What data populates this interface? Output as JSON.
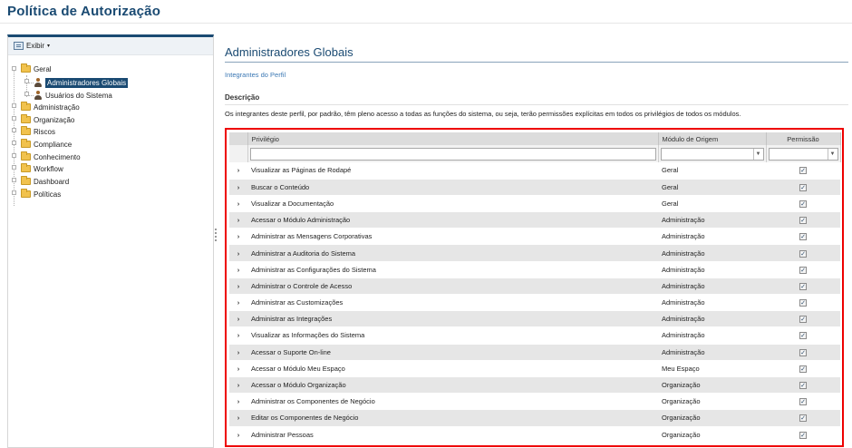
{
  "page": {
    "title": "Política de Autorização"
  },
  "sidebar": {
    "view_label": "Exibir",
    "tree": [
      {
        "label": "Geral",
        "type": "folder",
        "children": [
          {
            "label": "Administradores Globais",
            "type": "user",
            "selected": true
          },
          {
            "label": "Usuários do Sistema",
            "type": "user",
            "selected": false
          }
        ]
      },
      {
        "label": "Administração",
        "type": "folder"
      },
      {
        "label": "Organização",
        "type": "folder"
      },
      {
        "label": "Riscos",
        "type": "folder"
      },
      {
        "label": "Compliance",
        "type": "folder"
      },
      {
        "label": "Conhecimento",
        "type": "folder"
      },
      {
        "label": "Workflow",
        "type": "folder"
      },
      {
        "label": "Dashboard",
        "type": "folder"
      },
      {
        "label": "Políticas",
        "type": "folder"
      }
    ]
  },
  "main": {
    "title": "Administradores Globais",
    "profile_link": "Integrantes do Perfil",
    "description_heading": "Descrição",
    "description_text": "Os integrantes deste perfil, por padrão, têm pleno acesso a todas as funções do sistema, ou seja, terão permissões explícitas em todos os privilégios de todos os módulos.",
    "grid": {
      "columns": [
        "Privilégio",
        "Módulo de Origem",
        "Permissão"
      ],
      "filter_placeholder": "",
      "rows": [
        {
          "privilege": "Visualizar as Páginas de Rodapé",
          "module": "Geral",
          "permission": true
        },
        {
          "privilege": "Buscar o Conteúdo",
          "module": "Geral",
          "permission": true
        },
        {
          "privilege": "Visualizar a Documentação",
          "module": "Geral",
          "permission": true
        },
        {
          "privilege": "Acessar o Módulo Administração",
          "module": "Administração",
          "permission": true
        },
        {
          "privilege": "Administrar as Mensagens Corporativas",
          "module": "Administração",
          "permission": true
        },
        {
          "privilege": "Administrar a Auditoria do Sistema",
          "module": "Administração",
          "permission": true
        },
        {
          "privilege": "Administrar as Configurações do Sistema",
          "module": "Administração",
          "permission": true
        },
        {
          "privilege": "Administrar o Controle de Acesso",
          "module": "Administração",
          "permission": true
        },
        {
          "privilege": "Administrar as Customizações",
          "module": "Administração",
          "permission": true
        },
        {
          "privilege": "Administrar as Integrações",
          "module": "Administração",
          "permission": true
        },
        {
          "privilege": "Visualizar as Informações do Sistema",
          "module": "Administração",
          "permission": true
        },
        {
          "privilege": "Acessar o Suporte On-line",
          "module": "Administração",
          "permission": true
        },
        {
          "privilege": "Acessar o Módulo Meu Espaço",
          "module": "Meu Espaço",
          "permission": true
        },
        {
          "privilege": "Acessar o Módulo Organização",
          "module": "Organização",
          "permission": true
        },
        {
          "privilege": "Administrar os Componentes de Negócio",
          "module": "Organização",
          "permission": true
        },
        {
          "privilege": "Editar os Componentes de Negócio",
          "module": "Organização",
          "permission": true
        },
        {
          "privilege": "Administrar Pessoas",
          "module": "Organização",
          "permission": true
        }
      ]
    }
  }
}
